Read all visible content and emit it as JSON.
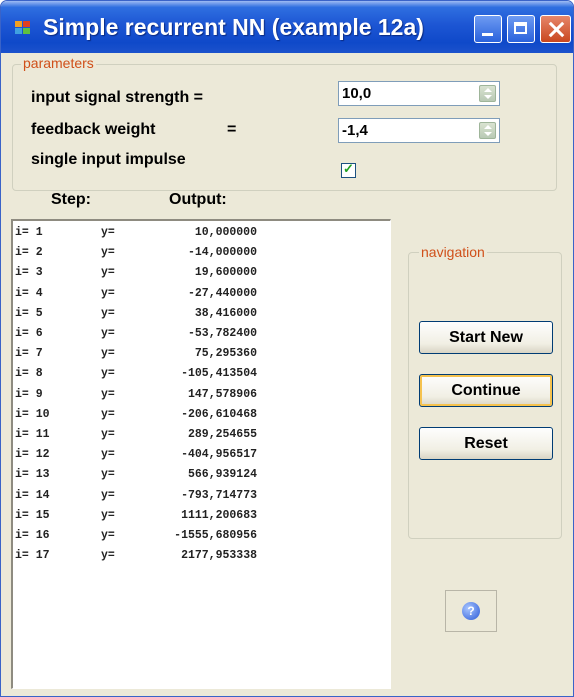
{
  "window": {
    "title": "Simple recurrent NN (example 12a)"
  },
  "parameters": {
    "legend": "parameters",
    "input_signal_strength": {
      "label": "input signal strength =",
      "value": "10,0"
    },
    "feedback_weight": {
      "label": "feedback weight",
      "eq": "=",
      "value": "-1,4"
    },
    "single_input_impulse": {
      "label": "single input impulse",
      "checked": true
    }
  },
  "list": {
    "step_header": "Step:",
    "output_header": "Output:",
    "rows": [
      {
        "step": "i=  1",
        "y": "y=",
        "out": "10,000000"
      },
      {
        "step": "i=  2",
        "y": "y=",
        "out": "-14,000000"
      },
      {
        "step": "i=  3",
        "y": "y=",
        "out": "19,600000"
      },
      {
        "step": "i=  4",
        "y": "y=",
        "out": "-27,440000"
      },
      {
        "step": "i=  5",
        "y": "y=",
        "out": "38,416000"
      },
      {
        "step": "i=  6",
        "y": "y=",
        "out": "-53,782400"
      },
      {
        "step": "i=  7",
        "y": "y=",
        "out": "75,295360"
      },
      {
        "step": "i=  8",
        "y": "y=",
        "out": "-105,413504"
      },
      {
        "step": "i=  9",
        "y": "y=",
        "out": "147,578906"
      },
      {
        "step": "i= 10",
        "y": "y=",
        "out": "-206,610468"
      },
      {
        "step": "i= 11",
        "y": "y=",
        "out": "289,254655"
      },
      {
        "step": "i= 12",
        "y": "y=",
        "out": "-404,956517"
      },
      {
        "step": "i= 13",
        "y": "y=",
        "out": "566,939124"
      },
      {
        "step": "i= 14",
        "y": "y=",
        "out": "-793,714773"
      },
      {
        "step": "i= 15",
        "y": "y=",
        "out": "1111,200683"
      },
      {
        "step": "i= 16",
        "y": "y=",
        "out": "-1555,680956"
      },
      {
        "step": "i= 17",
        "y": "y=",
        "out": "2177,953338"
      }
    ]
  },
  "navigation": {
    "legend": "navigation",
    "start_new": "Start New",
    "continue": "Continue",
    "reset": "Reset"
  },
  "help": {
    "icon": "help-icon",
    "glyph": "?"
  },
  "colors": {
    "titlebar": "#1d56d4",
    "face": "#ece9d8",
    "close": "#c9471f"
  }
}
